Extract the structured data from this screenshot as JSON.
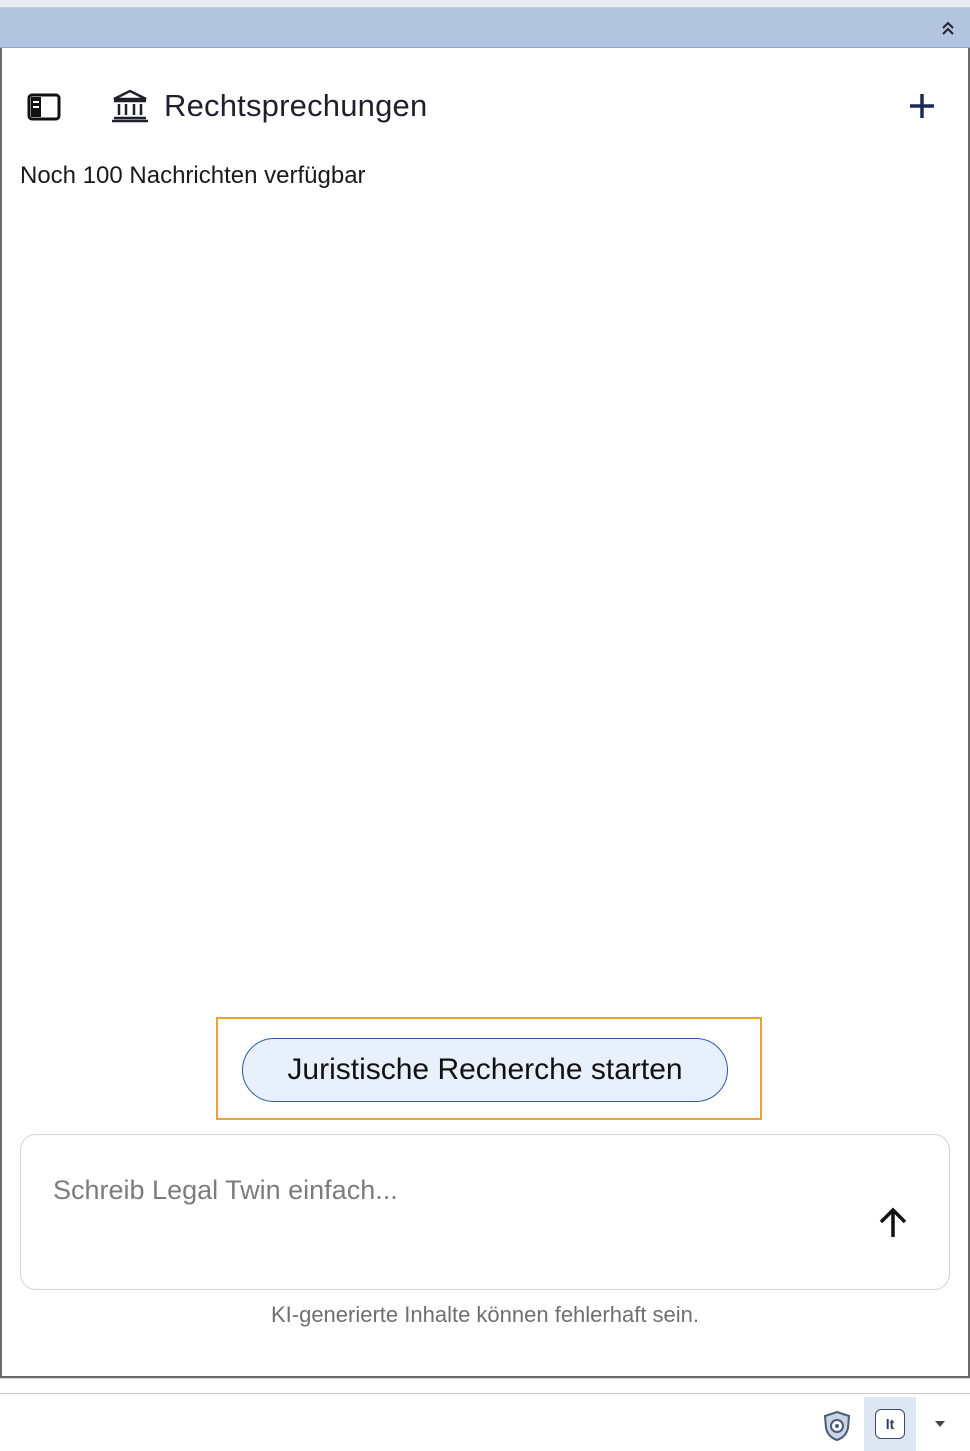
{
  "header": {
    "title": "Rechtsprechungen",
    "title_icon": "courthouse-icon",
    "sidebar_icon": "sidebar-toggle-icon",
    "new_icon": "plus-icon",
    "collapse_icon": "double-chevron-up-icon"
  },
  "quota": {
    "text": "Noch 100 Nachrichten verfügbar"
  },
  "suggestion": {
    "label": "Juristische Recherche starten"
  },
  "composer": {
    "placeholder": "Schreib Legal Twin einfach...",
    "value": "",
    "send_icon": "arrow-up-icon"
  },
  "disclaimer": "KI-generierte Inhalte können fehlerhaft sein.",
  "tray": {
    "lt_label": "lt",
    "shield_icon": "shield-icon",
    "caret_icon": "caret-down-icon"
  },
  "colors": {
    "header_bar": "#b3c4df",
    "chip_border": "#2f5aa8",
    "chip_fill": "#e8f0fb",
    "highlight": "#e8a533",
    "title_text": "#1f1f2e"
  }
}
